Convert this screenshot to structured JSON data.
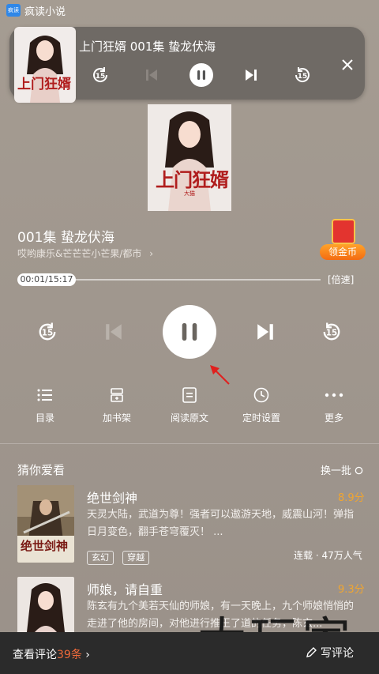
{
  "status_bar": {
    "app_badge": "疯读",
    "app_name": "疯读小说"
  },
  "mini_player": {
    "title": "上门狂婿 001集 蛰龙伏海",
    "cover_text": "上门狂婿"
  },
  "cover": {
    "title": "上门狂婿",
    "author_tag": "大猫"
  },
  "episode": {
    "title": "001集 蛰龙伏海",
    "subtitle": "哎哟康乐&芒芒芒小芒果/都市",
    "chevron": "›"
  },
  "reward": {
    "label": "领金币"
  },
  "progress": {
    "time": "00:01/15:17",
    "fraction": 0.001,
    "speed_label": "[倍速]"
  },
  "controls": {
    "rewind_label": "15",
    "forward_label": "15"
  },
  "actions": [
    {
      "label": "目录",
      "icon": "list-icon"
    },
    {
      "label": "加书架",
      "icon": "bookshelf-icon"
    },
    {
      "label": "阅读原文",
      "icon": "read-icon"
    },
    {
      "label": "定时设置",
      "icon": "timer-icon"
    },
    {
      "label": "更多",
      "icon": "more-icon"
    }
  ],
  "recommend": {
    "title": "猜你爱看",
    "refresh": "换一批",
    "books": [
      {
        "title": "绝世剑神",
        "score": "8.9分",
        "desc": "天灵大陆，武道为尊！强者可以遨游天地，威震山河！弹指日月变色，翻手苍穹覆灭！ ...",
        "tags": [
          "玄幻",
          "穿越"
        ],
        "stat": "连载 · 47万人气",
        "cover_text": "绝世剑神"
      },
      {
        "title": "师娘，请自重",
        "score": "9.3分",
        "desc": "陈玄有九个美若天仙的师娘，有一天晚上，九个师娘悄悄的走进了他的房间，对他进行推王了道的任务，陈玄..."
      }
    ]
  },
  "bottom_bar": {
    "comments_label": "查看评论",
    "comments_count": "39条",
    "chevron": "›",
    "write_label": "写评论"
  },
  "watermark": {
    "text": "大玩家"
  },
  "colors": {
    "accent_orange": "#f26b3a",
    "score": "#f0a531",
    "app_badge": "#2f87e8"
  }
}
